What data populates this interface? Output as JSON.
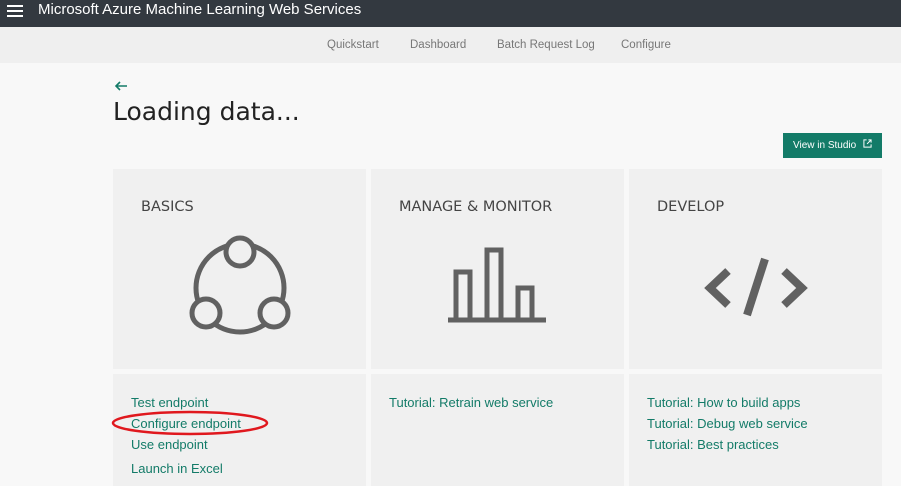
{
  "app": {
    "title": "Microsoft Azure Machine Learning Web Services"
  },
  "nav": {
    "items": [
      {
        "label": "Quickstart"
      },
      {
        "label": "Dashboard"
      },
      {
        "label": "Batch Request Log"
      },
      {
        "label": "Configure"
      }
    ]
  },
  "page": {
    "back_icon": "back-arrow-icon",
    "title": "Loading data..."
  },
  "toolbar": {
    "view_in_studio_label": "View in Studio",
    "external_link_icon": "external-link-icon"
  },
  "cards": [
    {
      "title": "BASICS",
      "icon": "network-nodes-icon"
    },
    {
      "title": "MANAGE & MONITOR",
      "icon": "bar-chart-icon"
    },
    {
      "title": "DEVELOP",
      "icon": "code-brackets-icon"
    }
  ],
  "links": {
    "basics": [
      {
        "label": "Test endpoint"
      },
      {
        "label": "Configure endpoint"
      },
      {
        "label": "Use endpoint"
      },
      {
        "label": "Launch in Excel"
      }
    ],
    "manage": [
      {
        "label": "Tutorial: Retrain web service"
      }
    ],
    "develop": [
      {
        "label": "Tutorial: How to build apps"
      },
      {
        "label": "Tutorial: Debug web service"
      },
      {
        "label": "Tutorial: Best practices"
      }
    ]
  },
  "colors": {
    "accent": "#137b68",
    "topbar": "#333940",
    "annotation": "#e0181e"
  }
}
